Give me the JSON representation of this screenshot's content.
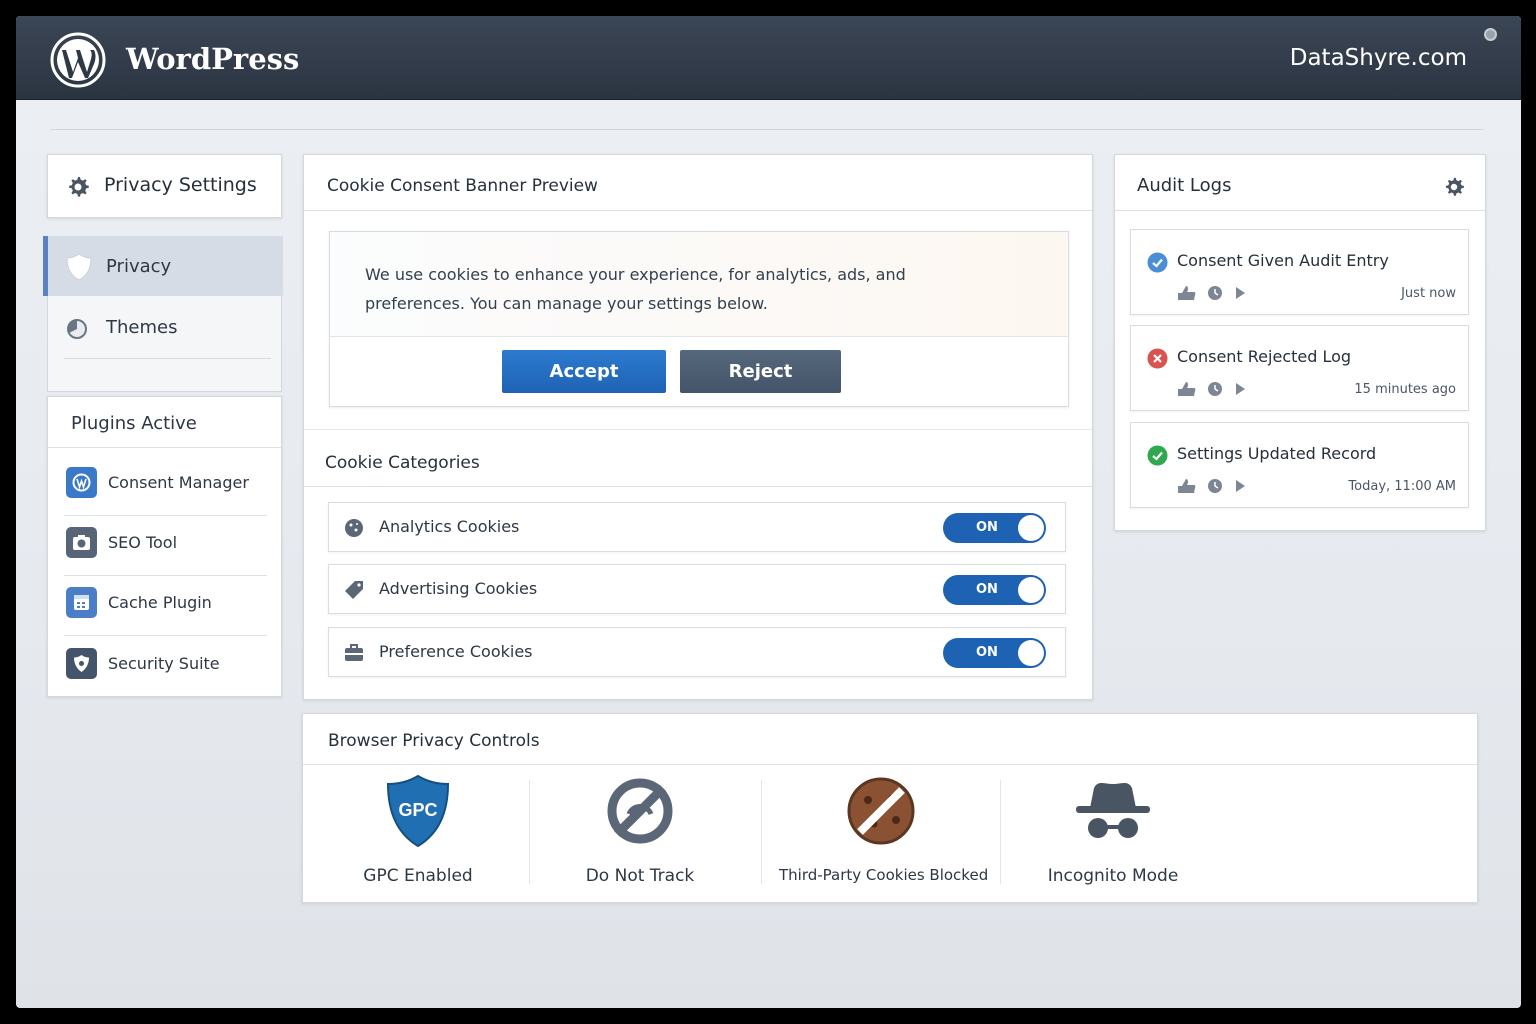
{
  "header": {
    "brand": "WordPress",
    "site": "DataShyre.com"
  },
  "sidebar": {
    "title": "Privacy Settings",
    "nav": [
      {
        "label": "Privacy",
        "icon": "shield-icon",
        "active": true
      },
      {
        "label": "Themes",
        "icon": "palette-icon",
        "active": false
      }
    ],
    "plugins_heading": "Plugins Active",
    "plugins": [
      {
        "label": "Consent Manager",
        "icon": "wordpress-icon",
        "color": "#3a78c9"
      },
      {
        "label": "SEO Tool",
        "icon": "camera-icon",
        "color": "#566577"
      },
      {
        "label": "Cache Plugin",
        "icon": "calendar-icon",
        "color": "#4a7fc7"
      },
      {
        "label": "Security Suite",
        "icon": "shield-icon",
        "color": "#44546a"
      }
    ]
  },
  "consent": {
    "title": "Cookie Consent Banner Preview",
    "message": "We use cookies to enhance your experience, for analytics, ads, and preferences. You can manage your settings below.",
    "accept_label": "Accept",
    "reject_label": "Reject",
    "categories_title": "Cookie Categories",
    "categories": [
      {
        "label": "Analytics Cookies",
        "icon": "cookie-icon",
        "state": "ON"
      },
      {
        "label": "Advertising Cookies",
        "icon": "tag-icon",
        "state": "ON"
      },
      {
        "label": "Preference Cookies",
        "icon": "briefcase-icon",
        "state": "ON"
      }
    ]
  },
  "audit": {
    "title": "Audit Logs",
    "entries": [
      {
        "title": "Consent Given Audit Entry",
        "status": "info",
        "color": "#4a8fd6",
        "time": "Just now"
      },
      {
        "title": "Consent Rejected Log",
        "status": "error",
        "color": "#d9534f",
        "time": "15 minutes ago"
      },
      {
        "title": "Settings Updated Record",
        "status": "success",
        "color": "#2fa84f",
        "time": "Today, 11:00 AM"
      }
    ]
  },
  "browser_privacy": {
    "title": "Browser Privacy Controls",
    "controls": [
      {
        "label": "GPC Enabled",
        "icon": "gpc-shield-icon",
        "badge": "GPC"
      },
      {
        "label": "Do Not Track",
        "icon": "do-not-track-icon"
      },
      {
        "label": "Third-Party Cookies Blocked",
        "icon": "blocked-cookie-icon"
      },
      {
        "label": "Incognito Mode",
        "icon": "incognito-icon"
      }
    ]
  }
}
